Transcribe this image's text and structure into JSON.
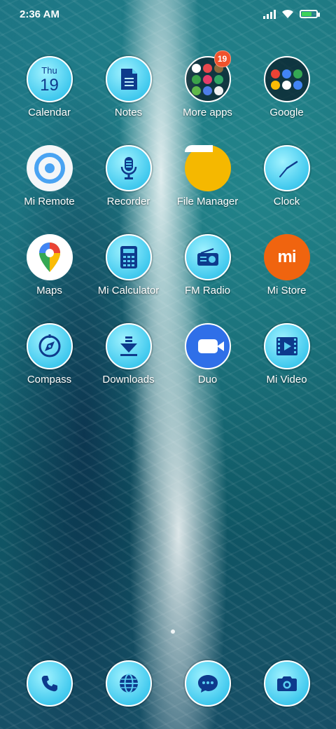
{
  "status_bar": {
    "time": "2:36 AM",
    "icons": [
      "signal-icon",
      "wifi-icon",
      "battery-charging-icon"
    ],
    "battery_color": "#3ed35a"
  },
  "calendar_icon": {
    "day": "Thu",
    "date": "19"
  },
  "apps": [
    {
      "label": "Calendar",
      "icon": "calendar-icon"
    },
    {
      "label": "Notes",
      "icon": "notes-icon"
    },
    {
      "label": "More apps",
      "icon": "folder-icon",
      "badge": "19"
    },
    {
      "label": "Google",
      "icon": "folder-icon"
    },
    {
      "label": "Mi Remote",
      "icon": "remote-icon"
    },
    {
      "label": "Recorder",
      "icon": "microphone-icon"
    },
    {
      "label": "File Manager",
      "icon": "folder-file-icon"
    },
    {
      "label": "Clock",
      "icon": "clock-icon"
    },
    {
      "label": "Maps",
      "icon": "map-pin-icon"
    },
    {
      "label": "Mi Calculator",
      "icon": "calculator-icon"
    },
    {
      "label": "FM Radio",
      "icon": "radio-icon"
    },
    {
      "label": "Mi Store",
      "icon": "mi-logo-icon",
      "logo_text": "mi"
    },
    {
      "label": "Compass",
      "icon": "compass-icon"
    },
    {
      "label": "Downloads",
      "icon": "download-icon"
    },
    {
      "label": "Duo",
      "icon": "video-camera-icon"
    },
    {
      "label": "Mi Video",
      "icon": "film-icon"
    }
  ],
  "dock": [
    {
      "icon": "phone-icon"
    },
    {
      "icon": "globe-icon"
    },
    {
      "icon": "message-icon"
    },
    {
      "icon": "camera-icon"
    }
  ],
  "colors": {
    "icon_blue": "#41c9ee",
    "glyph_navy": "#0d3a8c",
    "badge": "#f0522c",
    "mi_store": "#f0640f",
    "file_manager": "#f5b800",
    "duo": "#2f6fe8"
  }
}
